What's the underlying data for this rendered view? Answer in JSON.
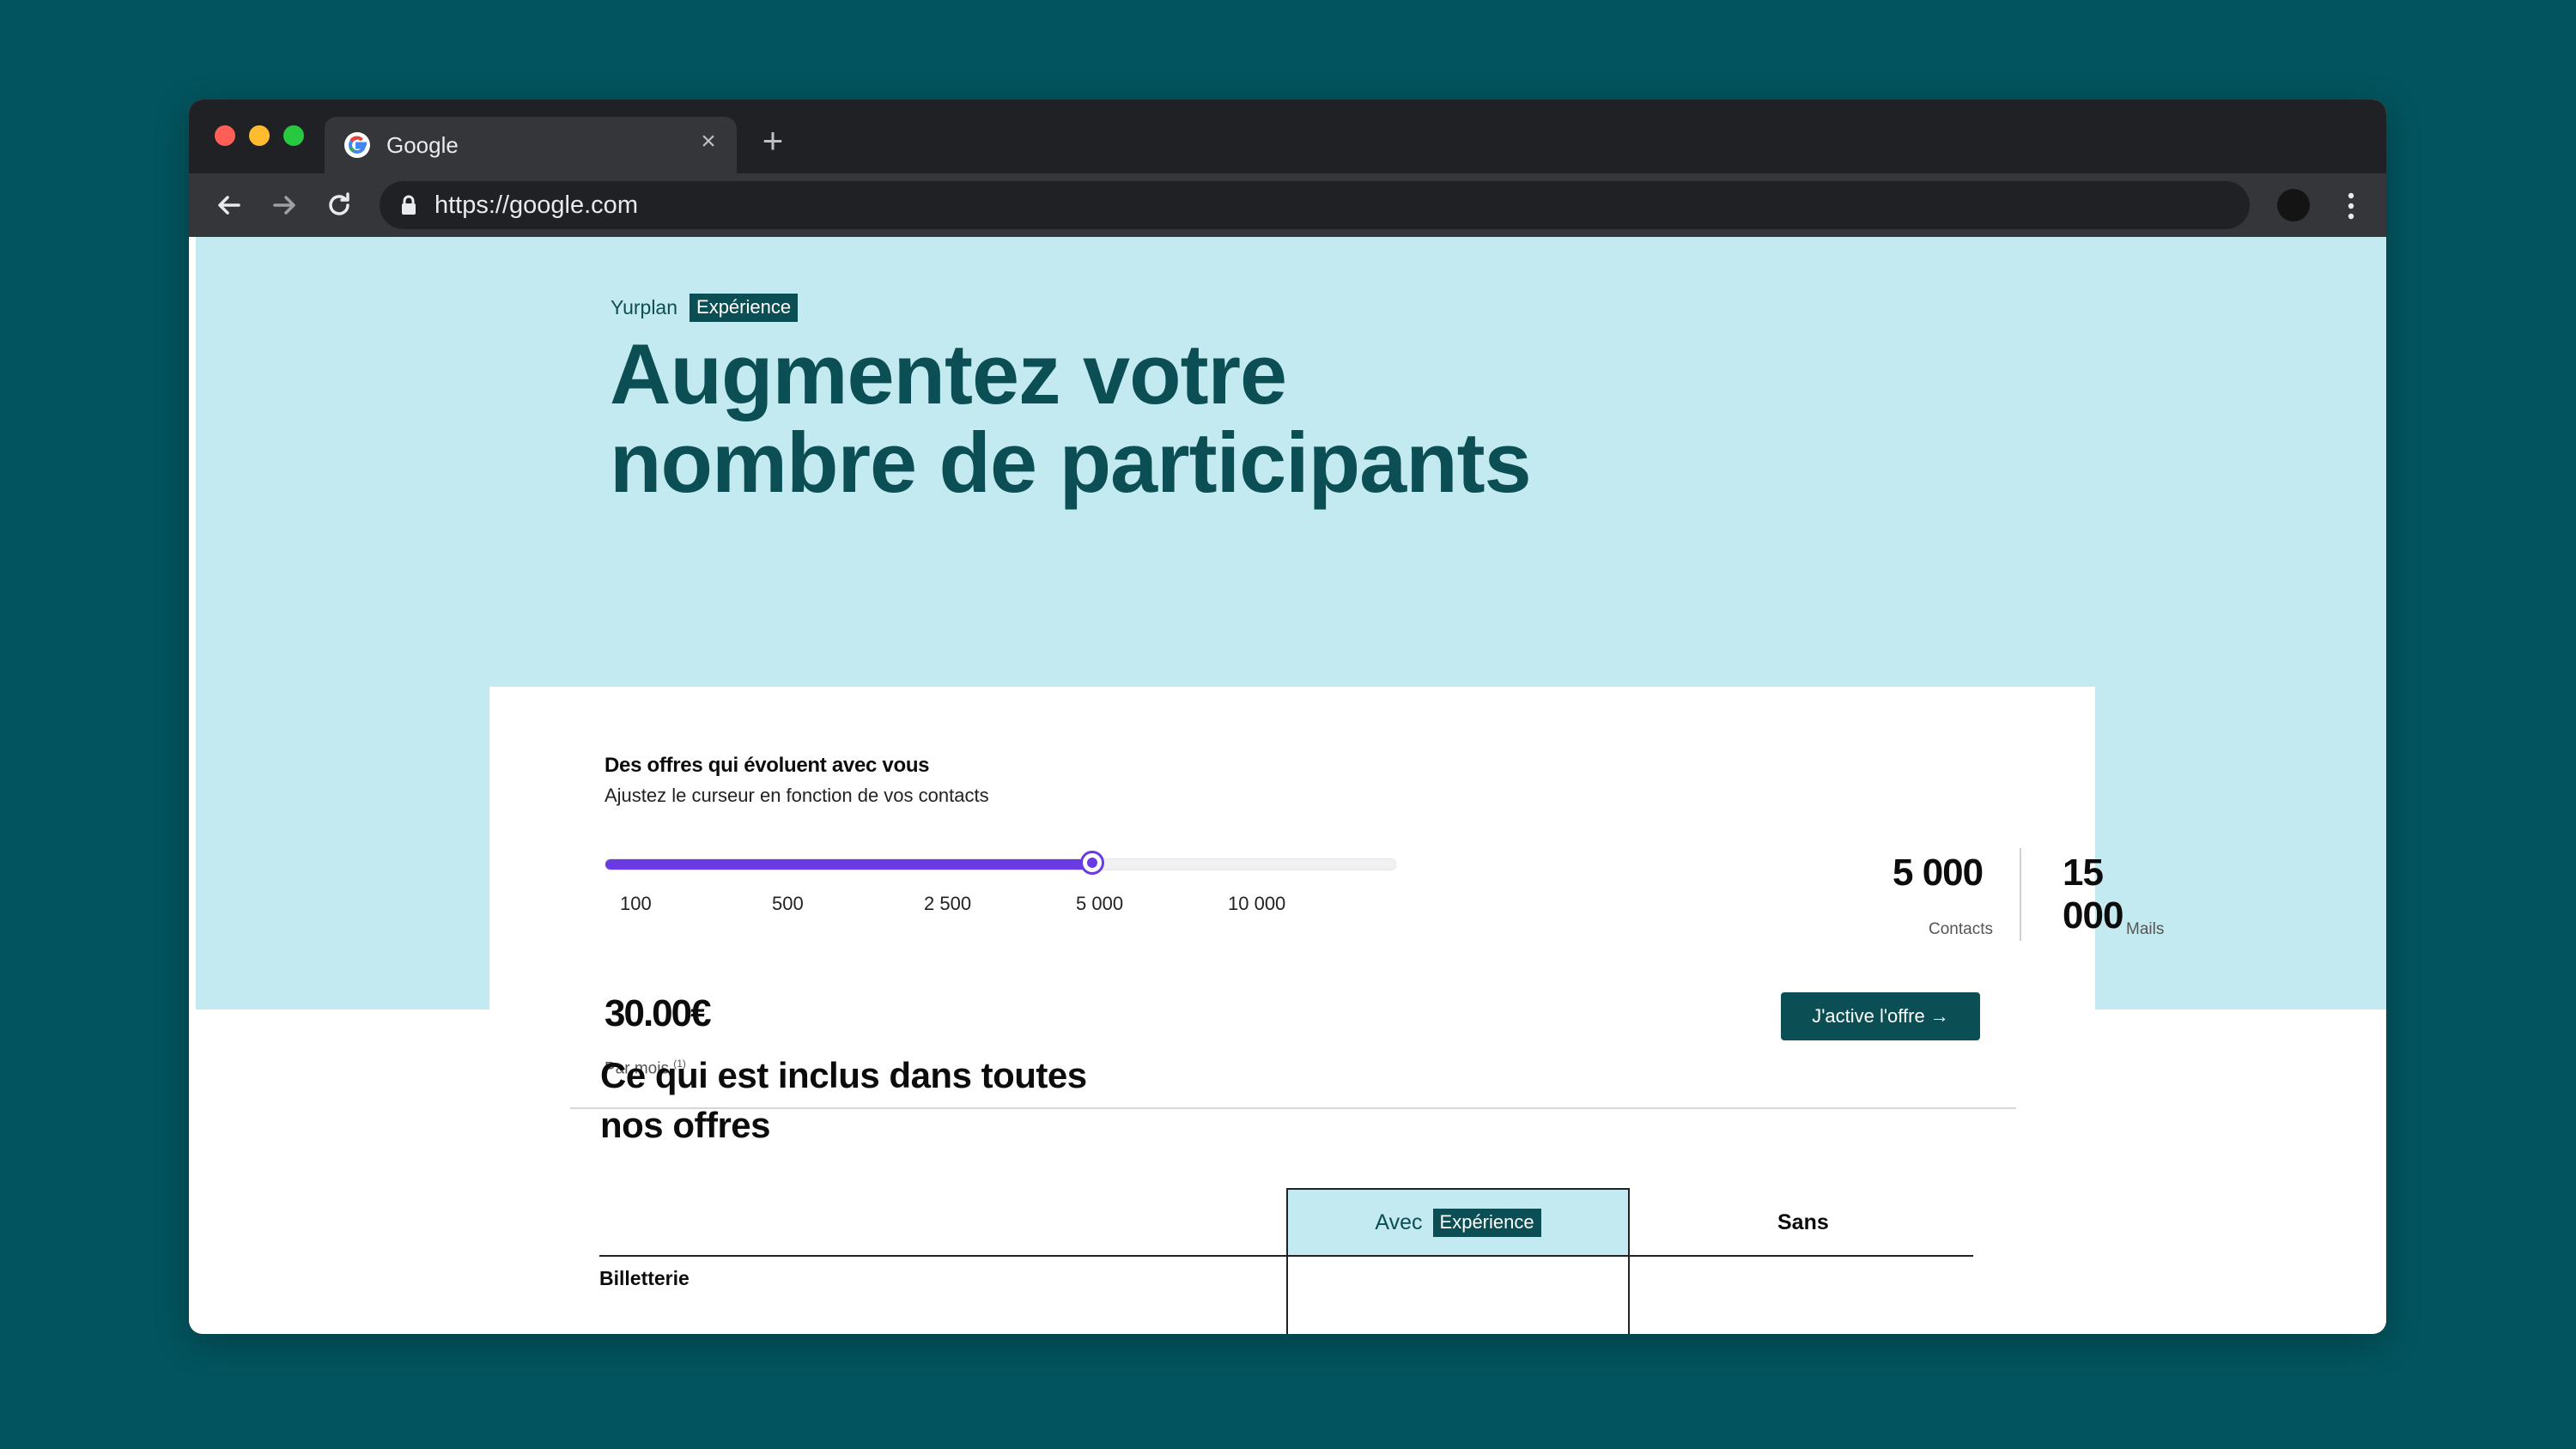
{
  "browser": {
    "tab_title": "Google",
    "tab_close": "×",
    "new_tab": "+",
    "url": "https://google.com"
  },
  "hero": {
    "brand": "Yurplan",
    "tag": "Expérience",
    "headline_line1": "Augmentez votre",
    "headline_line2": "nombre de participants"
  },
  "pricing": {
    "title": "Des offres qui évoluent avec vous",
    "subtitle": "Ajustez le curseur en fonction de vos contacts",
    "slider": {
      "ticks": [
        "100",
        "500",
        "2 500",
        "5 000",
        "10 000"
      ],
      "selected": "5 000",
      "selected_index": 3
    },
    "contacts_value": "5 000",
    "contacts_label": "Contacts",
    "mails_value": "15 000",
    "mails_label": "Mails",
    "price": "30.00€",
    "price_note": "Par mois",
    "price_note_sup": "(1)",
    "cta_label": "J'active l'offre →"
  },
  "included": {
    "title_line1": "Ce qui est inclus dans toutes",
    "title_line2": "nos offres",
    "col_with_label": "Avec",
    "col_with_tag": "Expérience",
    "col_without_label": "Sans",
    "rows": [
      "Billetterie"
    ]
  },
  "colors": {
    "background": "#02545e",
    "brand_dark": "#0b4f55",
    "hero_bg": "#c3eaf0",
    "slider_accent": "#6a3be4"
  }
}
